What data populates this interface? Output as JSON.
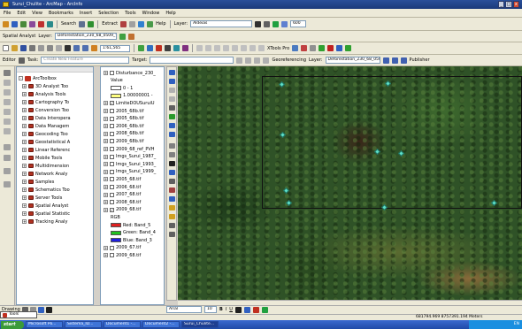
{
  "window": {
    "title": "Surui_Chulite - ArcMap - ArcInfo",
    "buttons": {
      "min": "_",
      "max": "□",
      "close": "x"
    }
  },
  "menu": [
    "File",
    "Edit",
    "View",
    "Bookmarks",
    "Insert",
    "Selection",
    "Tools",
    "Window",
    "Help"
  ],
  "toolbar1": {
    "search_label": "Search",
    "extract_label": "Extract",
    "help_label": "Help",
    "layer_label": "Layer:",
    "layer_value": "Aldeias",
    "zoom_value": "600"
  },
  "toolbar2": {
    "spatial_analyst": "Spatial Analyst",
    "layer_label": "Layer:",
    "layer_value": "Deforestation_230_68_0509_Yea"
  },
  "toolbar3": {
    "scale": "1:61,565",
    "xtools": "XTools Pro"
  },
  "toolbar4": {
    "editor": "Editor",
    "task_label": "Task:",
    "task_value": "Create New Feature",
    "target_label": "Target:",
    "georef": "Georeferencing",
    "layer_label": "Layer:",
    "layer_value": "Deforestation_230_68_0509_Yea.t",
    "publisher": "Publisher"
  },
  "toolbox": {
    "root": "ArcToolbox",
    "items": [
      "3D Analyst Too",
      "Analysis Tools",
      "Cartography To",
      "Conversion Too",
      "Data Interopera",
      "Data Managem",
      "Geocoding Too",
      "Geostatistical A",
      "Linear Referenc",
      "Mobile Tools",
      "Multidimension",
      "Network Analy",
      "Samples",
      "Schematics Too",
      "Server Tools",
      "Spatial Analyst",
      "Spatial Statistic",
      "Tracking Analy"
    ],
    "tabs": [
      "Favorites",
      "Index"
    ]
  },
  "toc": {
    "items": [
      {
        "label": "Disturbance_230_",
        "indent": 0,
        "kind": "layer",
        "checked": false
      },
      {
        "label": "Value",
        "indent": 2,
        "kind": "text"
      },
      {
        "label": "0 - 1",
        "indent": 2,
        "kind": "swatch",
        "color": "#ffffff"
      },
      {
        "label": "1.00000001 -",
        "indent": 2,
        "kind": "swatch",
        "color": "#ffff80"
      },
      {
        "label": "LimiteDOUSuruiU",
        "indent": 0,
        "kind": "layer",
        "checked": true
      },
      {
        "label": "2005_68b.tif",
        "indent": 0,
        "kind": "layer",
        "checked": false
      },
      {
        "label": "2005_68b.tif",
        "indent": 0,
        "kind": "layer",
        "checked": false
      },
      {
        "label": "2006_68b.tif",
        "indent": 0,
        "kind": "layer",
        "checked": false
      },
      {
        "label": "2008_68b.tif",
        "indent": 0,
        "kind": "layer",
        "checked": false
      },
      {
        "label": "2009_68b.tif",
        "indent": 0,
        "kind": "layer",
        "checked": false
      },
      {
        "label": "2009_68_ref_PVH",
        "indent": 0,
        "kind": "layer",
        "checked": false
      },
      {
        "label": "Imgs_Surui_1987_",
        "indent": 0,
        "kind": "layer",
        "checked": false
      },
      {
        "label": "Imgs_Surui_1993_",
        "indent": 0,
        "kind": "layer",
        "checked": false
      },
      {
        "label": "Imgs_Surui_1999_",
        "indent": 0,
        "kind": "layer",
        "checked": false
      },
      {
        "label": "2005_68.tif",
        "indent": 0,
        "kind": "layer",
        "checked": false
      },
      {
        "label": "2006_68.tif",
        "indent": 0,
        "kind": "layer",
        "checked": false
      },
      {
        "label": "2007_68.tif",
        "indent": 0,
        "kind": "layer",
        "checked": false
      },
      {
        "label": "2008_68.tif",
        "indent": 0,
        "kind": "layer",
        "checked": false
      },
      {
        "label": "2009_68.tif",
        "indent": 0,
        "kind": "layer",
        "checked": true
      },
      {
        "label": "RGB",
        "indent": 2,
        "kind": "text"
      },
      {
        "label": "Red: Band_5",
        "indent": 2,
        "kind": "swatch",
        "color": "#e02020"
      },
      {
        "label": "Green: Band_4",
        "indent": 2,
        "kind": "swatch",
        "color": "#20c020"
      },
      {
        "label": "Blue: Band_3",
        "indent": 2,
        "kind": "swatch",
        "color": "#2020e0"
      },
      {
        "label": "2009_67.tif",
        "indent": 0,
        "kind": "layer",
        "checked": false
      },
      {
        "label": "2009_68.tif",
        "indent": 0,
        "kind": "layer",
        "checked": false
      }
    ],
    "tabs": [
      "Display",
      "Source",
      "Selection"
    ]
  },
  "drawing": {
    "label": "Drawing",
    "font": "Arial",
    "font_size": "10"
  },
  "status": {
    "coords": "681794.969  8757391.194 Meters"
  },
  "taskbar": {
    "start": "start",
    "popup": "Tools",
    "tasks": [
      "Microsoft Po...",
      "Sistema_ID...",
      "Document1 -...",
      "Document2 -...",
      "Surui_Chulite..."
    ],
    "tray": "EN"
  }
}
